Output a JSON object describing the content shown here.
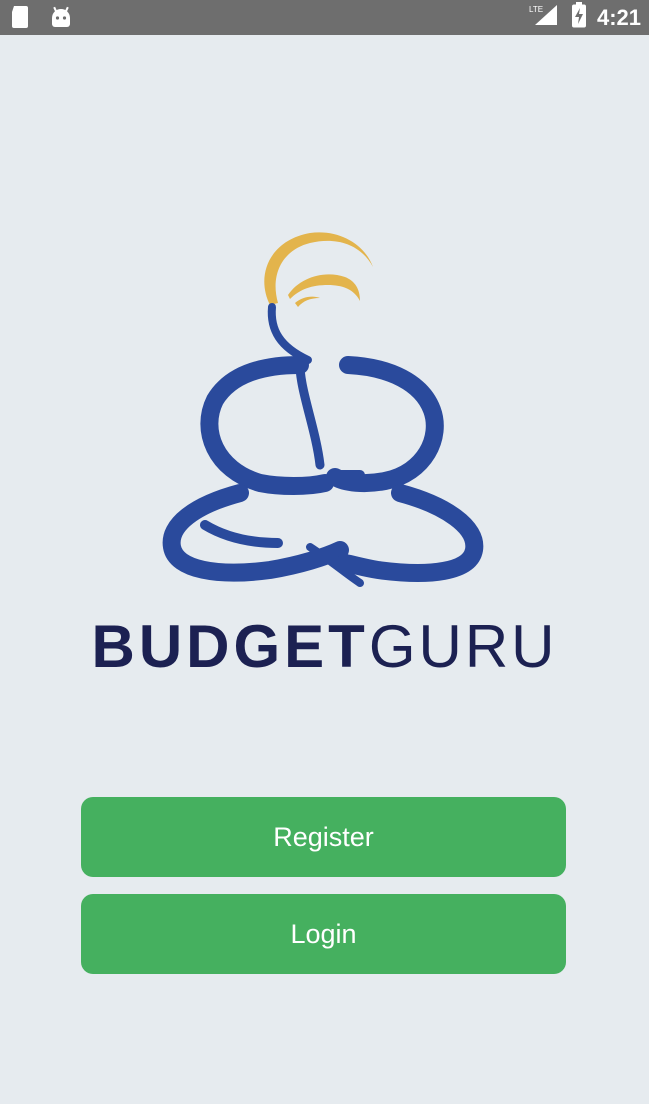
{
  "status_bar": {
    "time": "4:21",
    "network": "LTE",
    "icons": [
      "sd-card-icon",
      "android-icon",
      "lte-signal-icon",
      "battery-charging-icon"
    ]
  },
  "brand": {
    "name_part1": "BUDGET",
    "name_part2": "GURU",
    "logo_icon": "meditating-guru-logo",
    "colors": {
      "primary_blue": "#2a4a9c",
      "hair_gold": "#e3b44c",
      "text_navy": "#1c2152"
    }
  },
  "actions": {
    "register_label": "Register",
    "login_label": "Login",
    "button_color": "#45b05f"
  }
}
